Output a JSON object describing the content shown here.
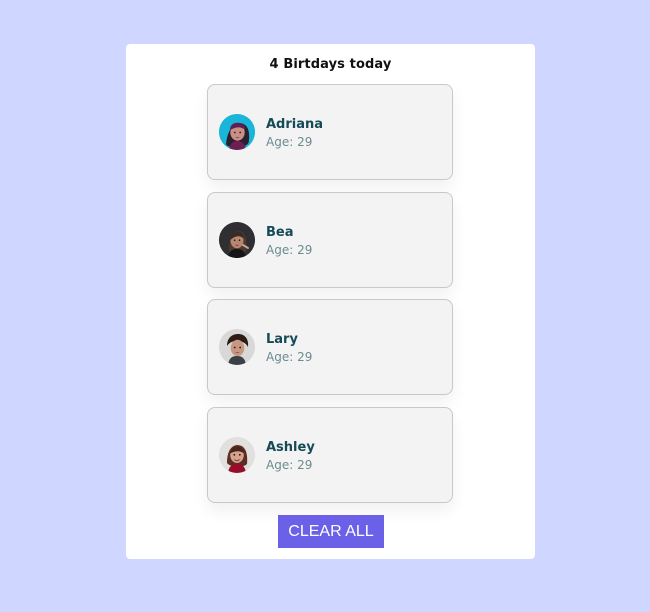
{
  "panel": {
    "title": "4 Birtdays today"
  },
  "people": [
    {
      "name": "Adriana",
      "age_label": "Age: 29",
      "avatar_icon": "person-avatar-icon"
    },
    {
      "name": "Bea",
      "age_label": "Age: 29",
      "avatar_icon": "person-avatar-icon"
    },
    {
      "name": "Lary",
      "age_label": "Age: 29",
      "avatar_icon": "person-avatar-icon"
    },
    {
      "name": "Ashley",
      "age_label": "Age: 29",
      "avatar_icon": "person-avatar-icon"
    }
  ],
  "actions": {
    "clear_all_label": "CLEAR ALL"
  },
  "colors": {
    "background": "#cfd6ff",
    "panel": "#ffffff",
    "card": "#f3f3f3",
    "name": "#164a57",
    "age": "#6b8b90",
    "button": "#6a61e8"
  }
}
